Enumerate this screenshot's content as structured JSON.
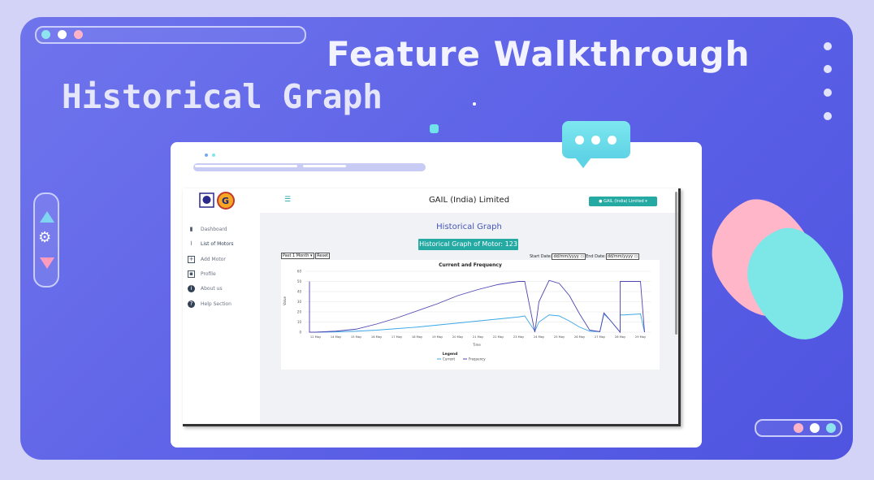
{
  "slide": {
    "heading": "Feature Walkthrough",
    "subheading": "Historical Graph"
  },
  "app": {
    "company": "GAIL (India) Limited",
    "user_button": "GAIL (India) Limited",
    "sidebar": [
      {
        "label": "Dashboard",
        "icon": "bar-chart-icon"
      },
      {
        "label": "List of Motors",
        "icon": "line-chart-icon"
      },
      {
        "label": "Add Motor",
        "icon": "add-box-icon"
      },
      {
        "label": "Profile",
        "icon": "profile-card-icon"
      },
      {
        "label": "About us",
        "icon": "info-icon"
      },
      {
        "label": "Help Section",
        "icon": "help-icon"
      }
    ],
    "page_title": "Historical Graph",
    "motor_button": "Historical Graph of Motor: 123",
    "period_select": "Past 1 Month",
    "reset_button": "Reset",
    "start_label": "Start Date:",
    "end_label": "End Date:",
    "date_placeholder": "dd/mm/yyyy"
  },
  "colors": {
    "accent": "#25a9a3",
    "current": "#3aa7e6",
    "frequency": "#4d45b0"
  },
  "chart_data": {
    "type": "line",
    "title": "Current and Frequency",
    "xlabel": "Time",
    "ylabel": "Value",
    "ylim": [
      0,
      60
    ],
    "yticks": [
      0,
      10,
      20,
      30,
      40,
      50,
      60
    ],
    "categories": [
      "12 May",
      "14 May",
      "15 May",
      "16 May",
      "17 May",
      "18 May",
      "19 May",
      "20 May",
      "21 May",
      "22 May",
      "23 May",
      "24 May",
      "25 May",
      "26 May",
      "27 May",
      "28 May",
      "29 May"
    ],
    "legend_title": "Legend",
    "series": [
      {
        "name": "Current",
        "x": [
          0,
          1,
          2,
          3,
          4,
          5,
          6,
          7,
          8,
          9,
          10,
          10.3,
          10.8,
          11,
          11.5,
          12,
          12.5,
          13,
          13.5,
          14.0,
          14.2,
          14.5,
          15,
          15.0,
          15.2,
          16.0,
          16.2
        ],
        "values": [
          0,
          0.3,
          1,
          2,
          3.5,
          5,
          7,
          9,
          11,
          13,
          15,
          16,
          1,
          10,
          17,
          16,
          11,
          5,
          1,
          0.5,
          18,
          12,
          0,
          17,
          17,
          18,
          0
        ]
      },
      {
        "name": "Frequency",
        "x": [
          -0.3,
          -0.3,
          0,
          1,
          2,
          3,
          4,
          5,
          6,
          7,
          8,
          9,
          10,
          10.3,
          10.8,
          11,
          11.5,
          12,
          12.5,
          13,
          13.5,
          14.0,
          14.2,
          14.5,
          15,
          15.0,
          15.2,
          16.0,
          16.2
        ],
        "values": [
          50,
          0,
          0,
          1,
          3,
          8,
          14,
          21,
          28,
          36,
          42,
          47,
          50,
          50,
          0,
          30,
          51,
          48,
          36,
          18,
          2,
          0.5,
          19,
          12,
          0,
          50,
          50,
          50,
          0
        ]
      }
    ]
  }
}
